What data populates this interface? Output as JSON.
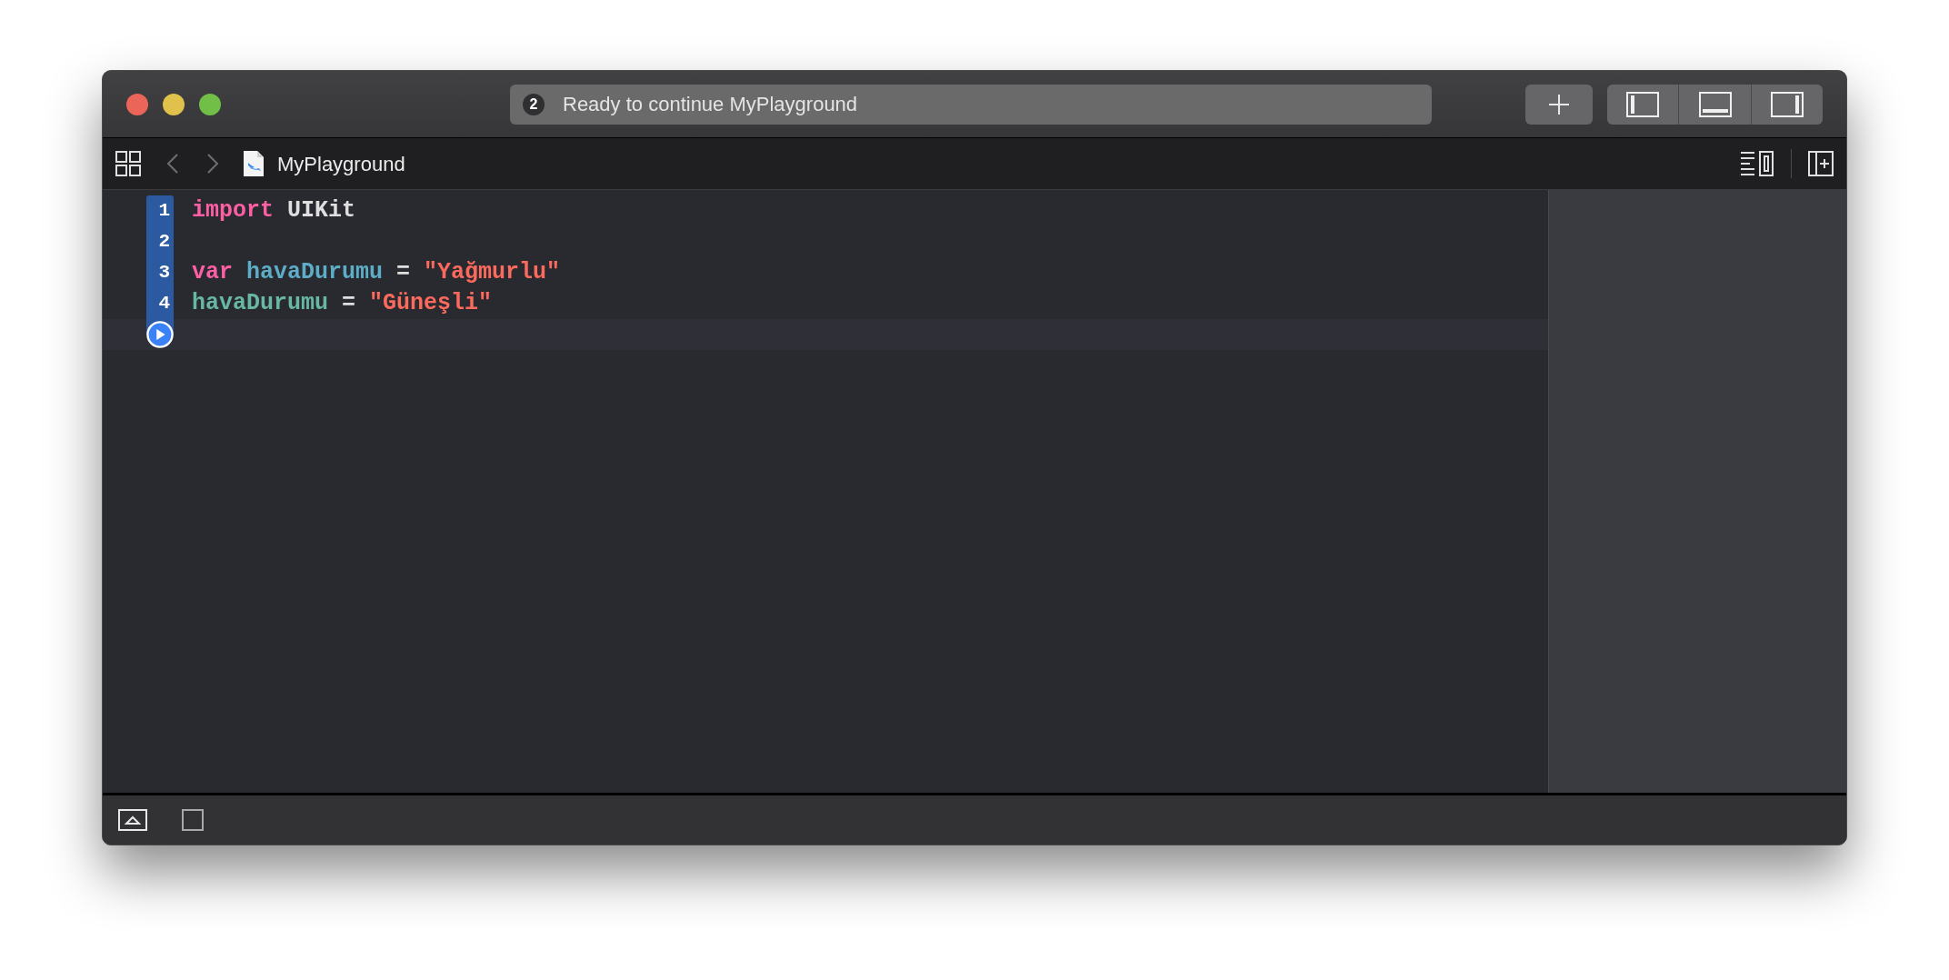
{
  "titlebar": {
    "status": {
      "badge": "2",
      "text": "Ready to continue MyPlayground"
    },
    "panel_toggles": [
      {
        "kind": "left",
        "on": false
      },
      {
        "kind": "bottom",
        "on": false
      },
      {
        "kind": "right",
        "on": false
      }
    ]
  },
  "toolbar": {
    "file_name": "MyPlayground"
  },
  "editor": {
    "lines": [
      {
        "number": "1",
        "executed": true,
        "tokens": [
          {
            "kind": "keyword",
            "text": "import"
          },
          {
            "kind": "plain",
            "text": "UIKit"
          }
        ]
      },
      {
        "number": "2",
        "executed": true
      },
      {
        "number": "3",
        "executed": true,
        "tokens": [
          {
            "kind": "keyword",
            "text": "var"
          },
          {
            "kind": "declaration",
            "text": "havaDurumu"
          },
          {
            "kind": "plain",
            "text": "="
          },
          {
            "kind": "string",
            "text": "\"Yağmurlu\""
          }
        ]
      },
      {
        "number": "4",
        "executed": true,
        "tokens": [
          {
            "kind": "identifier",
            "text": "havaDurumu"
          },
          {
            "kind": "plain",
            "text": "="
          },
          {
            "kind": "string",
            "text": "\"Güneşli\""
          }
        ]
      }
    ]
  }
}
